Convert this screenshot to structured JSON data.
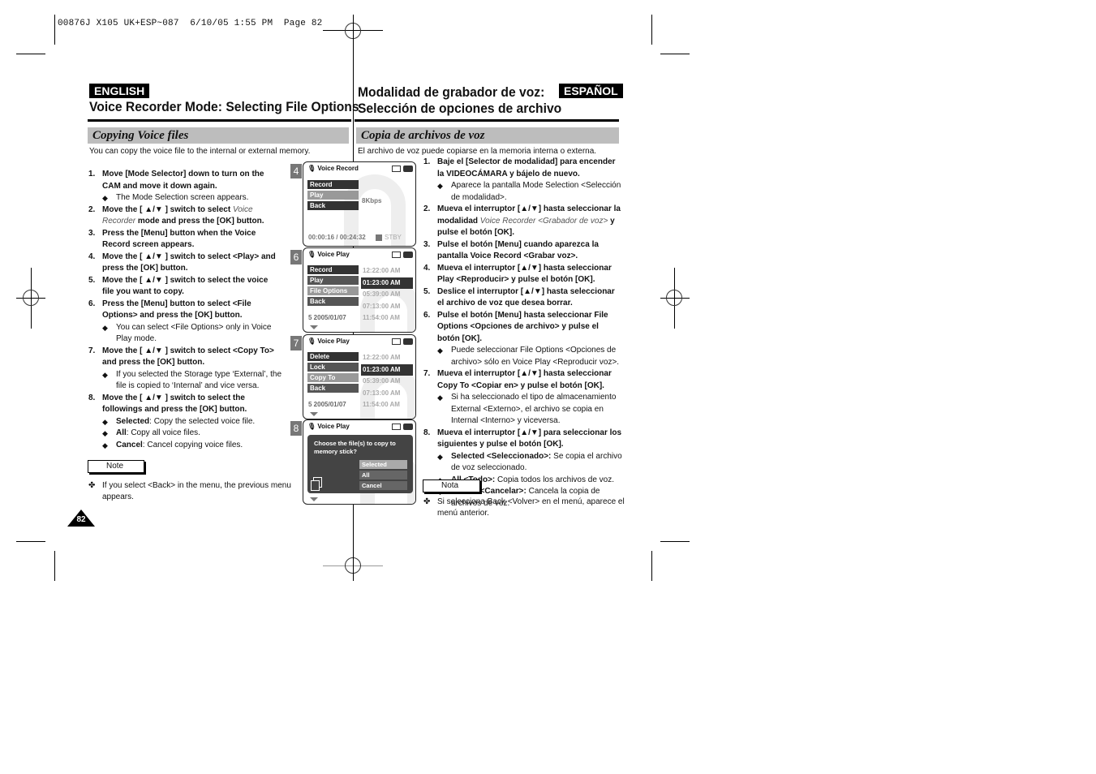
{
  "slug": "00876J X105 UK+ESP~087  6/10/05 1:55 PM  Page 82",
  "english": {
    "lang_label": "ENGLISH",
    "title": "Voice Recorder Mode: Selecting File Options",
    "section": "Copying Voice files",
    "intro": "You can copy the voice file to the internal or external memory.",
    "steps": [
      {
        "n": "1.",
        "text": "Move [Mode Selector] down to turn on the CAM and move it down again.",
        "bullets": [
          "The Mode Selection screen appears."
        ]
      },
      {
        "n": "2.",
        "pre": "Move the [ ▲/▼ ] switch to select ",
        "ital": "Voice Recorder",
        "post": " mode and press the [OK] button."
      },
      {
        "n": "3.",
        "text": "Press the [Menu] button when the Voice Record screen appears."
      },
      {
        "n": "4.",
        "text": "Move the [ ▲/▼ ] switch to select <Play> and press the [OK] button."
      },
      {
        "n": "5.",
        "text": "Move the [ ▲/▼ ] switch to select the voice file you want to copy."
      },
      {
        "n": "6.",
        "text": "Press the [Menu] button to select <File Options> and press the [OK] button.",
        "bullets": [
          "You can select <File Options> only in Voice Play mode."
        ]
      },
      {
        "n": "7.",
        "text": "Move the [ ▲/▼ ] switch to select <Copy To> and press the [OK] button.",
        "bullets": [
          "If you selected the Storage type ‘External’, the file is copied to ‘Internal’ and vice versa."
        ]
      },
      {
        "n": "8.",
        "text": "Move the [ ▲/▼ ] switch to select the followings and press the [OK] button.",
        "defs": [
          {
            "term": "Selected",
            "desc": ": Copy the selected voice file."
          },
          {
            "term": "All",
            "desc": ": Copy all voice files."
          },
          {
            "term": "Cancel",
            "desc": ": Cancel copying voice files."
          }
        ]
      }
    ],
    "note_label": "Note",
    "note": "If you select <Back> in the menu, the previous menu appears."
  },
  "spanish": {
    "lang_label": "ESPAÑOL",
    "title_line1": "Modalidad de grabador de voz:",
    "title_line2": "Selección de opciones de archivo",
    "section": "Copia de archivos de voz",
    "intro": "El archivo de voz puede copiarse en la memoria interna o externa.",
    "steps": [
      {
        "n": "1.",
        "text": "Baje el [Selector de modalidad] para encender la VIDEOCÁMARA y bájelo de nuevo.",
        "bullets": [
          "Aparece la pantalla Mode Selection <Selección de modalidad>."
        ]
      },
      {
        "n": "2.",
        "pre": "Mueva el interruptor [▲/▼] hasta seleccionar la modalidad ",
        "ital": "Voice Recorder <Grabador de voz>",
        "post": " y pulse el botón [OK]."
      },
      {
        "n": "3.",
        "text": "Pulse el botón [Menu] cuando aparezca la pantalla Voice Record <Grabar voz>."
      },
      {
        "n": "4.",
        "text": "Mueva el interruptor [▲/▼] hasta seleccionar Play <Reproducir> y pulse el botón [OK]."
      },
      {
        "n": "5.",
        "text": "Deslice el interruptor [▲/▼] hasta seleccionar el archivo de voz que desea borrar."
      },
      {
        "n": "6.",
        "text": "Pulse el botón [Menu] hasta seleccionar File Options <Opciones de archivo> y pulse el botón [OK].",
        "bullets": [
          "Puede seleccionar File Options <Opciones de archivo> sólo en Voice Play <Reproducir voz>."
        ]
      },
      {
        "n": "7.",
        "text": "Mueva el interruptor [▲/▼] hasta seleccionar Copy To <Copiar en> y pulse el botón [OK].",
        "bullets": [
          "Si ha seleccionado el tipo de almacenamiento External <Externo>, el archivo se copia en Internal <Interno> y viceversa."
        ]
      },
      {
        "n": "8.",
        "text": "Mueva el interruptor [▲/▼] para seleccionar los siguientes y pulse el botón [OK].",
        "defs": [
          {
            "term": "Selected <Seleccionado>:",
            "desc": " Se copia el archivo de voz seleccionado."
          },
          {
            "term": "All <Todo>:",
            "desc": " Copia todos los archivos de voz."
          },
          {
            "term": "Cancel <Cancelar>:",
            "desc": " Cancela la copia de archivos de voz."
          }
        ]
      }
    ],
    "note_label": "Nota",
    "note": "Si selecciona Back <Volver> en el menú, aparece el menú anterior."
  },
  "bullet_glyph": "◆",
  "note_glyph": "✤",
  "page_number": "82",
  "screens": [
    {
      "step": "4",
      "header": "Voice Record",
      "menu": [
        "Record",
        "Play",
        "Back"
      ],
      "selected": 1,
      "bitrate": "8Kbps",
      "time": "00:00:16 / 00:24:32",
      "status": "STBY"
    },
    {
      "step": "6",
      "header": "Voice Play",
      "menu": [
        "Record",
        "Play",
        "File Options",
        "Back"
      ],
      "selected": 2,
      "times": [
        "12:22:00 AM",
        "01:23:00 AM",
        "05:39:00 AM",
        "07:13:00 AM",
        "11:54:00 AM"
      ],
      "selected_time": 1,
      "last_date": "5  2005/01/07"
    },
    {
      "step": "7",
      "header": "Voice Play",
      "menu": [
        "Delete",
        "Lock",
        "Copy To",
        "Back"
      ],
      "selected": 2,
      "times": [
        "12:22:00 AM",
        "01:23:00 AM",
        "05:39:00 AM",
        "07:13:00 AM",
        "11:54:00 AM"
      ],
      "selected_time": 1,
      "last_date": "5  2005/01/07"
    },
    {
      "step": "8",
      "header": "Voice Play",
      "dialog_msg": "Choose the file(s) to copy to memory stick?",
      "options": [
        "Selected",
        "All",
        "Cancel"
      ],
      "selected": 0
    }
  ]
}
